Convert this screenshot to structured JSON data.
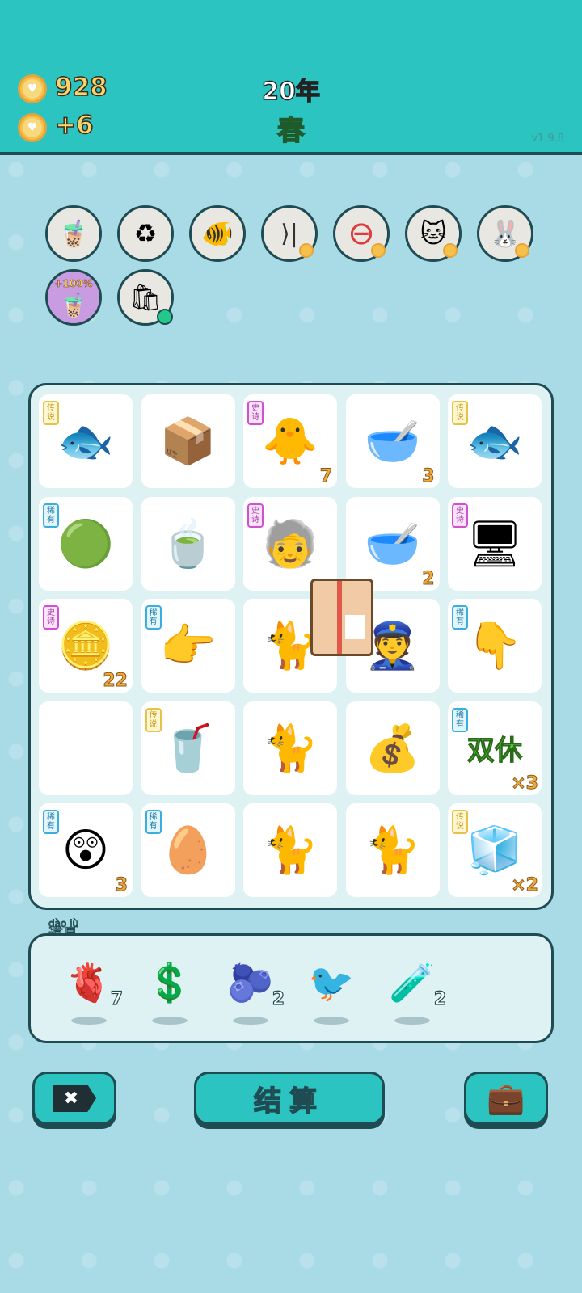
{
  "header": {
    "coins": "928",
    "income": "+6",
    "year": "20年",
    "season": "春",
    "version": "v1.9.8"
  },
  "relics": [
    {
      "icon": "bubble-tea-cup-icon"
    },
    {
      "icon": "recycle-trash-bag-icon"
    },
    {
      "icon": "fish-bowl-icon"
    },
    {
      "icon": "skip-icon"
    },
    {
      "icon": "remove-icon"
    },
    {
      "icon": "golden-cats-icon"
    },
    {
      "icon": "rabbit-icon"
    },
    {
      "icon": "bubble-tea-boost-icon",
      "badge": "+100%"
    },
    {
      "icon": "green-bag-icon"
    }
  ],
  "grid": [
    {
      "icon": "koi-fish-icon",
      "tag": "传说",
      "rarity": "legend",
      "emoji": "🐟"
    },
    {
      "icon": "cardboard-box-icon",
      "emoji": "📦"
    },
    {
      "icon": "yellow-chick-icon",
      "tag": "史诗",
      "rarity": "epic",
      "emoji": "🐥",
      "count": "7"
    },
    {
      "icon": "soup-bowl-icon",
      "emoji": "🥣",
      "count": "3"
    },
    {
      "icon": "koi-fish-icon",
      "tag": "传说",
      "rarity": "legend",
      "emoji": "🐟"
    },
    {
      "icon": "green-slime-ball-icon",
      "tag": "稀有",
      "rarity": "rare",
      "emoji": "🟢"
    },
    {
      "icon": "tea-bag-icon",
      "emoji": "🍵"
    },
    {
      "icon": "sunglasses-grandpa-icon",
      "tag": "史诗",
      "rarity": "epic",
      "emoji": "🧓"
    },
    {
      "icon": "soup-bowl-icon",
      "emoji": "🥣",
      "count": "2"
    },
    {
      "icon": "graphics-card-icon",
      "tag": "史诗",
      "rarity": "epic",
      "emoji": "🖥"
    },
    {
      "icon": "coin-stack-face-icon",
      "tag": "史诗",
      "rarity": "epic",
      "emoji": "🪙",
      "count": "22"
    },
    {
      "icon": "pointing-hand-icon",
      "tag": "稀有",
      "rarity": "rare",
      "emoji": "👉"
    },
    {
      "icon": "yellow-cat-icon",
      "emoji": "🐈"
    },
    {
      "icon": "police-officer-icon",
      "emoji": "👮"
    },
    {
      "icon": "pointing-down-hand-icon",
      "tag": "稀有",
      "rarity": "rare",
      "emoji": "👇"
    },
    {
      "icon": "empty-cell",
      "emoji": ""
    },
    {
      "icon": "bubble-tea-cup-icon",
      "tag": "传说",
      "rarity": "legend",
      "emoji": "🥤"
    },
    {
      "icon": "yellow-cat-icon",
      "emoji": "🐈"
    },
    {
      "icon": "coin-burst-icon",
      "emoji": "💰"
    },
    {
      "icon": "double-rest-icon",
      "tag": "稀有",
      "rarity": "rare",
      "text": "双休",
      "mult": "×3"
    },
    {
      "icon": "surprised-boy-icon",
      "tag": "稀有",
      "rarity": "rare",
      "emoji": "😲",
      "count": "3"
    },
    {
      "icon": "capsule-bowl-icon",
      "tag": "稀有",
      "rarity": "rare",
      "emoji": "🥚"
    },
    {
      "icon": "yellow-cat-icon",
      "emoji": "🐈"
    },
    {
      "icon": "yellow-cat-icon",
      "emoji": "🐈"
    },
    {
      "icon": "king-fridge-icon",
      "tag": "传说",
      "rarity": "legend",
      "emoji": "🧊",
      "mult": "×2"
    }
  ],
  "tools": {
    "label": "道具",
    "label_pinyin": "dào jù",
    "items": [
      {
        "icon": "liver-icon",
        "emoji": "🫀",
        "count": "7"
      },
      {
        "icon": "dollar-coin-icon",
        "emoji": "💲",
        "count": ""
      },
      {
        "icon": "blueberry-icon",
        "emoji": "🫐",
        "count": "2"
      },
      {
        "icon": "white-bird-icon",
        "emoji": "🐦",
        "count": ""
      },
      {
        "icon": "glass-tubes-icon",
        "emoji": "🧪",
        "count": "2"
      }
    ]
  },
  "buttons": {
    "remove_label": "✖",
    "settle_label": "结算",
    "bag_label": "💼"
  },
  "colors": {
    "teal": "#2cc4c0",
    "dark": "#1f4b53",
    "gold": "#f2a93b"
  }
}
